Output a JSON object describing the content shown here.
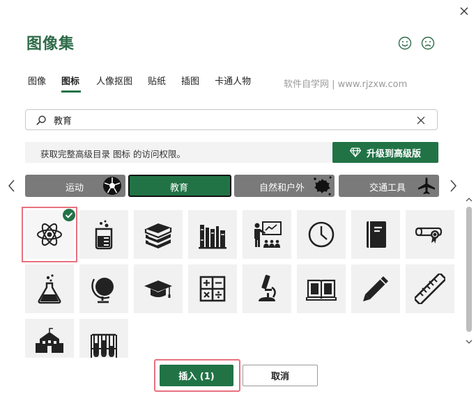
{
  "dialog": {
    "title": "图像集"
  },
  "tabs": [
    {
      "label": "图像",
      "active": false
    },
    {
      "label": "图标",
      "active": true
    },
    {
      "label": "人像抠图",
      "active": false
    },
    {
      "label": "贴纸",
      "active": false
    },
    {
      "label": "插图",
      "active": false
    },
    {
      "label": "卡通人物",
      "active": false
    }
  ],
  "watermark": "软件自学网 | www.rjzxw.com",
  "search": {
    "value": "教育"
  },
  "banner": {
    "text": "获取完整高级目录 图标 的访问权限。",
    "upgrade_label": "升级到高级版"
  },
  "categories": [
    {
      "label": "运动",
      "icon": "soccer-ball-icon"
    },
    {
      "label": "教育",
      "icon": "",
      "active": true
    },
    {
      "label": "自然和户外",
      "icon": "splash-icon"
    },
    {
      "label": "交通工具",
      "icon": "airplane-icon"
    }
  ],
  "icons": [
    {
      "name": "atom-icon",
      "selected": true
    },
    {
      "name": "beaker-icon"
    },
    {
      "name": "books-stack-icon"
    },
    {
      "name": "bookshelf-icon"
    },
    {
      "name": "teacher-classroom-icon"
    },
    {
      "name": "clock-icon"
    },
    {
      "name": "notebook-icon"
    },
    {
      "name": "diploma-icon"
    },
    {
      "name": "flask-icon"
    },
    {
      "name": "globe-icon"
    },
    {
      "name": "graduation-cap-icon"
    },
    {
      "name": "calculator-icon"
    },
    {
      "name": "microscope-icon"
    },
    {
      "name": "open-book-icon"
    },
    {
      "name": "pencil-icon"
    },
    {
      "name": "ruler-icon"
    },
    {
      "name": "school-icon"
    },
    {
      "name": "test-tubes-icon"
    }
  ],
  "footer": {
    "insert_label": "插入 (1)",
    "cancel_label": "取消"
  },
  "colors": {
    "accent": "#217346",
    "title": "#2d6a48",
    "selection": "#e8707e",
    "category": "#7a7a7a"
  }
}
